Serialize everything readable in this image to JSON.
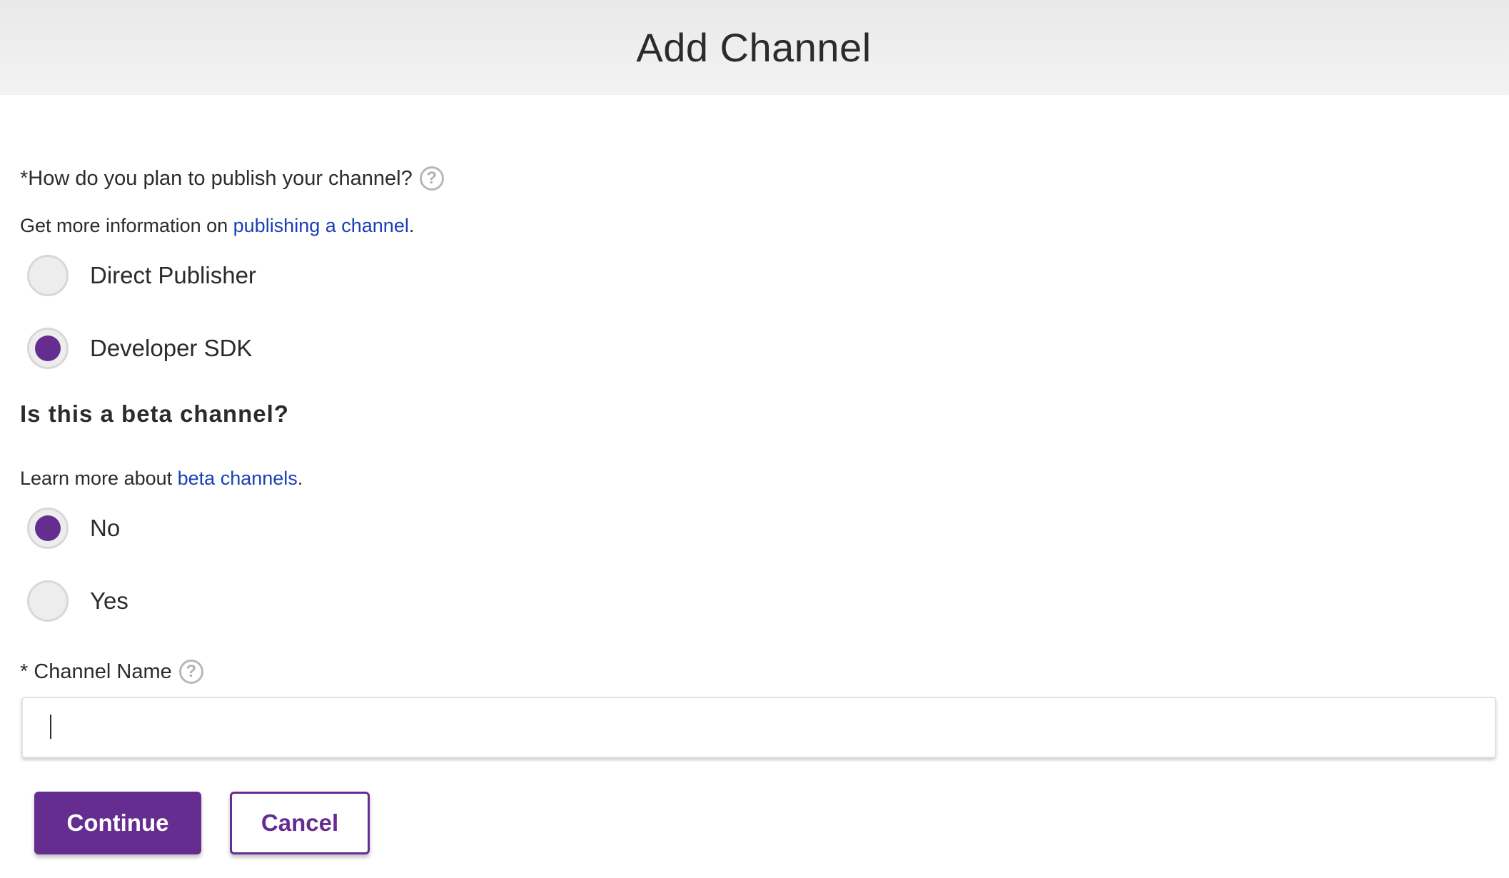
{
  "header": {
    "title": "Add Channel"
  },
  "publish": {
    "question": "*How do you plan to publish your channel?",
    "help_icon": "?",
    "info_prefix": "Get more information on ",
    "info_link": "publishing a channel",
    "info_suffix": ".",
    "options": [
      {
        "label": "Direct Publisher",
        "selected": false
      },
      {
        "label": "Developer SDK",
        "selected": true
      }
    ]
  },
  "beta": {
    "heading": "Is this a beta channel?",
    "info_prefix": "Learn more about ",
    "info_link": "beta channels",
    "info_suffix": ".",
    "options": [
      {
        "label": "No",
        "selected": true
      },
      {
        "label": "Yes",
        "selected": false
      }
    ]
  },
  "channel_name": {
    "label": "* Channel Name",
    "help_icon": "?",
    "value": "",
    "placeholder": ""
  },
  "actions": {
    "continue_label": "Continue",
    "cancel_label": "Cancel"
  },
  "colors": {
    "accent": "#662d91",
    "link": "#1a3fb5",
    "header_bg": "#eeeeee"
  },
  "icons": {
    "help": "question-circle-icon",
    "radio_selected": "radio-selected-icon",
    "radio_unselected": "radio-unselected-icon"
  }
}
